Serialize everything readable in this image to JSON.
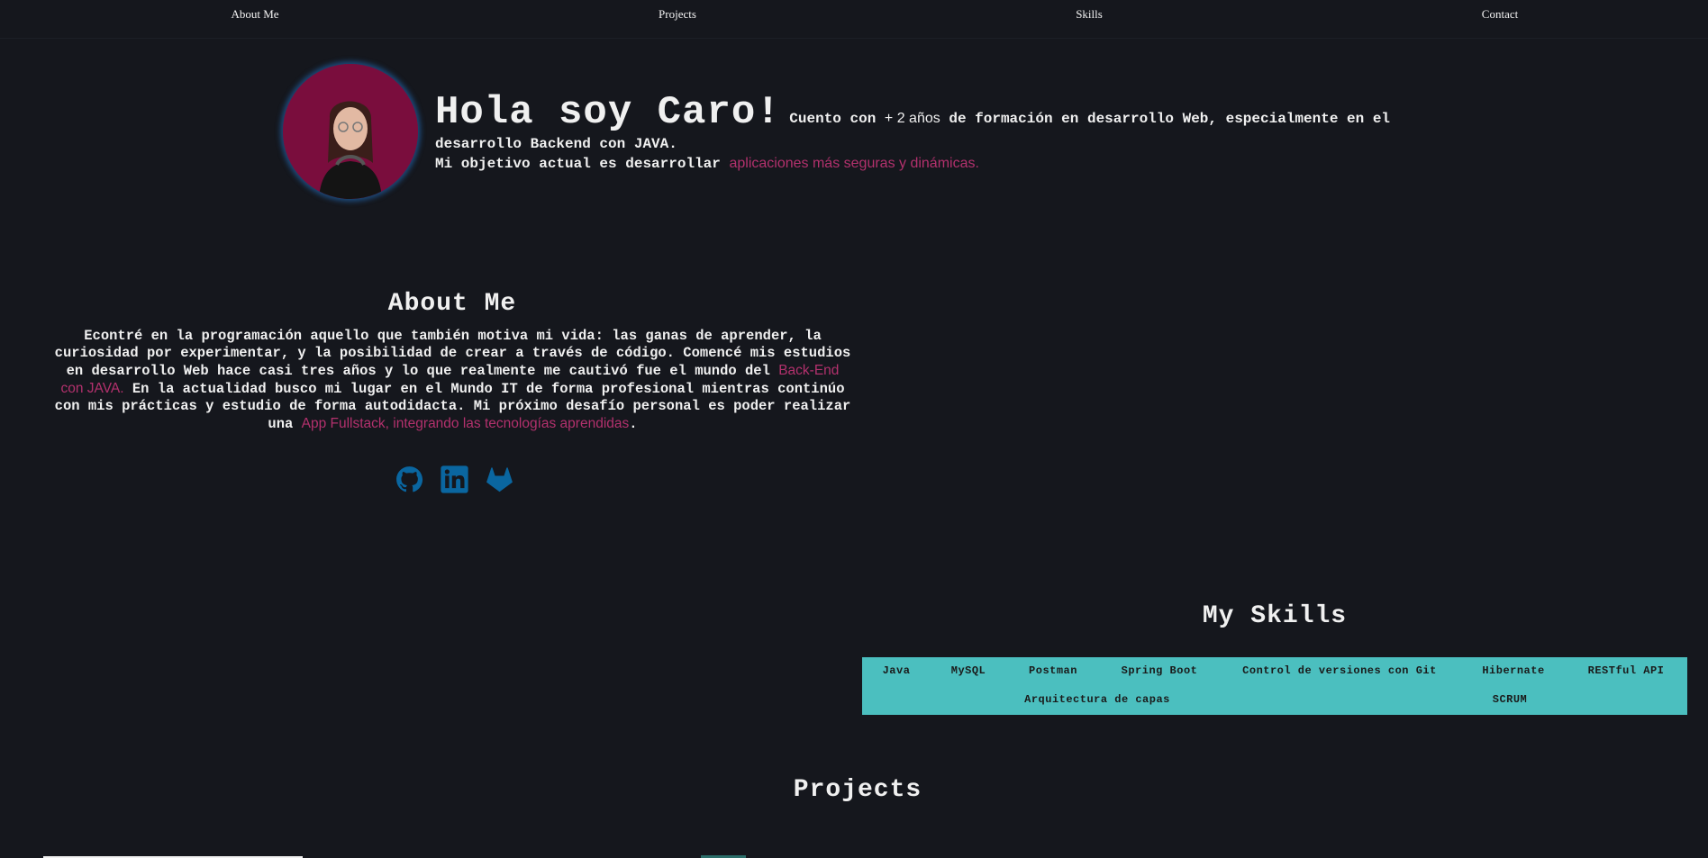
{
  "nav": {
    "items": [
      {
        "label": "About Me"
      },
      {
        "label": "Projects"
      },
      {
        "label": "Skills"
      },
      {
        "label": "Contact"
      }
    ]
  },
  "hero": {
    "title": "Hola soy Caro!",
    "line1_a": "Cuento con",
    "line1_highlight": "+ 2 años",
    "line1_b": "de formación en desarrollo Web, especialmente en el desarrollo Backend con JAVA.",
    "line2_a": "Mi objetivo actual es desarrollar",
    "line2_highlight": "aplicaciones más seguras y dinámicas."
  },
  "about": {
    "title": "About Me",
    "text_a": "Econtré en la programación aquello que también motiva mi vida: las ganas de aprender, la curiosidad por experimentar, y la posibilidad de crear a través de código. Comencé mis estudios en desarrollo Web hace casi tres años y lo que realmente me cautivó fue el mundo del",
    "highlight_1": "Back-End con JAVA.",
    "text_b": "En la actualidad busco mi lugar en el Mundo IT de forma profesional mientras continúo con mis prácticas y estudio de forma autodidacta. Mi próximo desafío personal es poder realizar una",
    "highlight_2": "App Fullstack, integrando las tecnologías aprendidas",
    "text_c": "."
  },
  "socials": [
    {
      "icon": "github-icon"
    },
    {
      "icon": "linkedin-icon"
    },
    {
      "icon": "gitlab-icon"
    }
  ],
  "skills": {
    "title": "My Skills",
    "items": [
      "Java",
      "MySQL",
      "Postman",
      "Spring Boot",
      "Control de versiones con Git",
      "Hibernate",
      "RESTful API",
      "Arquitectura de capas",
      "SCRUM"
    ]
  },
  "projects": {
    "title": "Projects"
  },
  "colors": {
    "background": "#15171d",
    "accent": "#b3316d",
    "skills_bar": "#4bbfbf",
    "icon_blue": "#0a66a0"
  }
}
